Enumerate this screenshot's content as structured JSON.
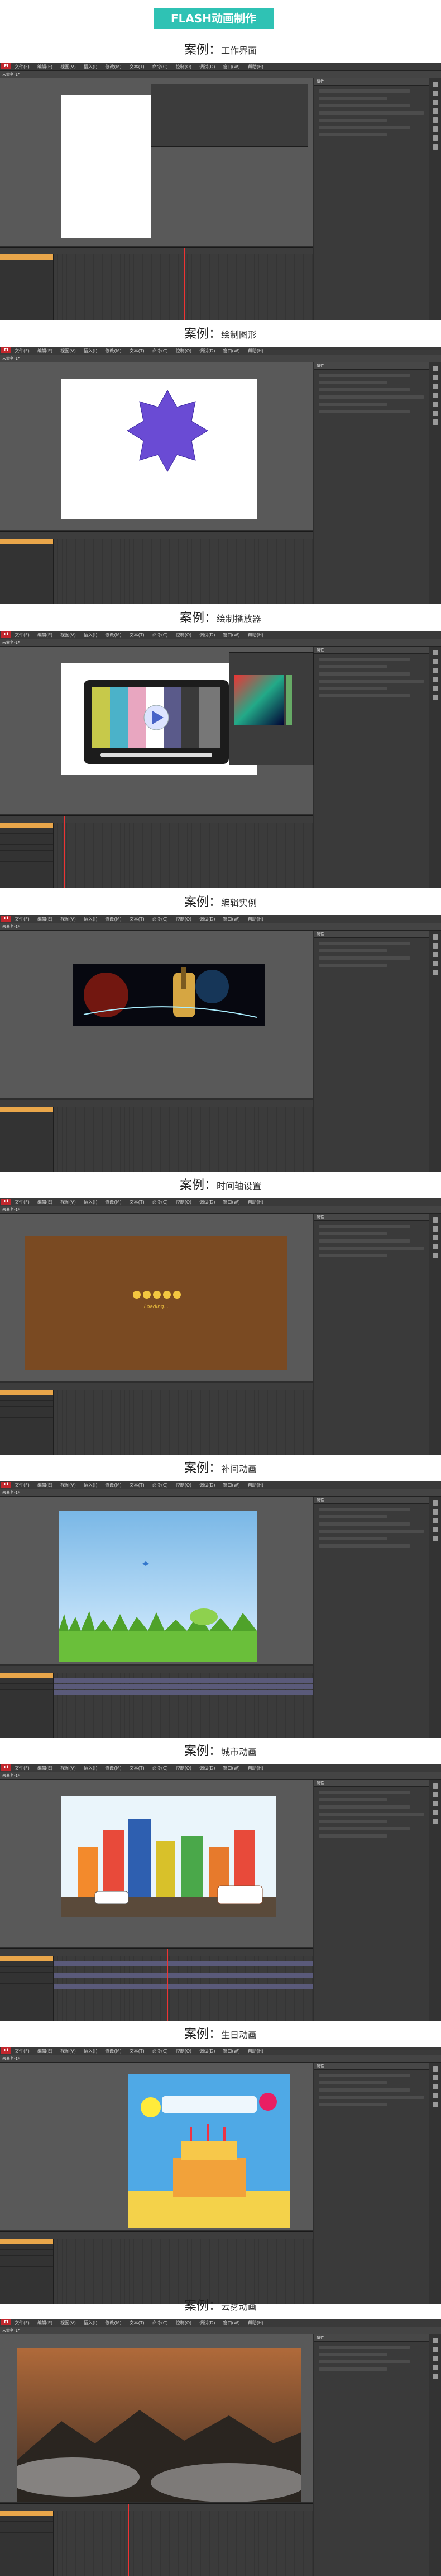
{
  "header": {
    "title": "FLASH动画制作"
  },
  "app": {
    "logo": "Fl",
    "menus": [
      "文件(F)",
      "编辑(E)",
      "视图(V)",
      "插入(I)",
      "修改(M)",
      "文本(T)",
      "命令(C)",
      "控制(O)",
      "调试(D)",
      "窗口(W)",
      "帮助(H)"
    ],
    "doc_tab": "未命名-1*",
    "props_header": "属性"
  },
  "cases": [
    {
      "prefix": "案例：",
      "name": "工作界面"
    },
    {
      "prefix": "案例：",
      "name": "绘制图形"
    },
    {
      "prefix": "案例：",
      "name": "绘制播放器"
    },
    {
      "prefix": "案例：",
      "name": "编辑实例"
    },
    {
      "prefix": "案例：",
      "name": "时间轴设置"
    },
    {
      "prefix": "案例：",
      "name": "补间动画"
    },
    {
      "prefix": "案例：",
      "name": "城市动画"
    },
    {
      "prefix": "案例：",
      "name": "生日动画"
    },
    {
      "prefix": "案例：",
      "name": "云雾动画"
    }
  ],
  "loading_text": "Loading...",
  "colors": {
    "badge": "#2fc2b4",
    "star": "#6a4bd4",
    "stage": "#ffffff",
    "ui_dark": "#2e2e2e"
  }
}
